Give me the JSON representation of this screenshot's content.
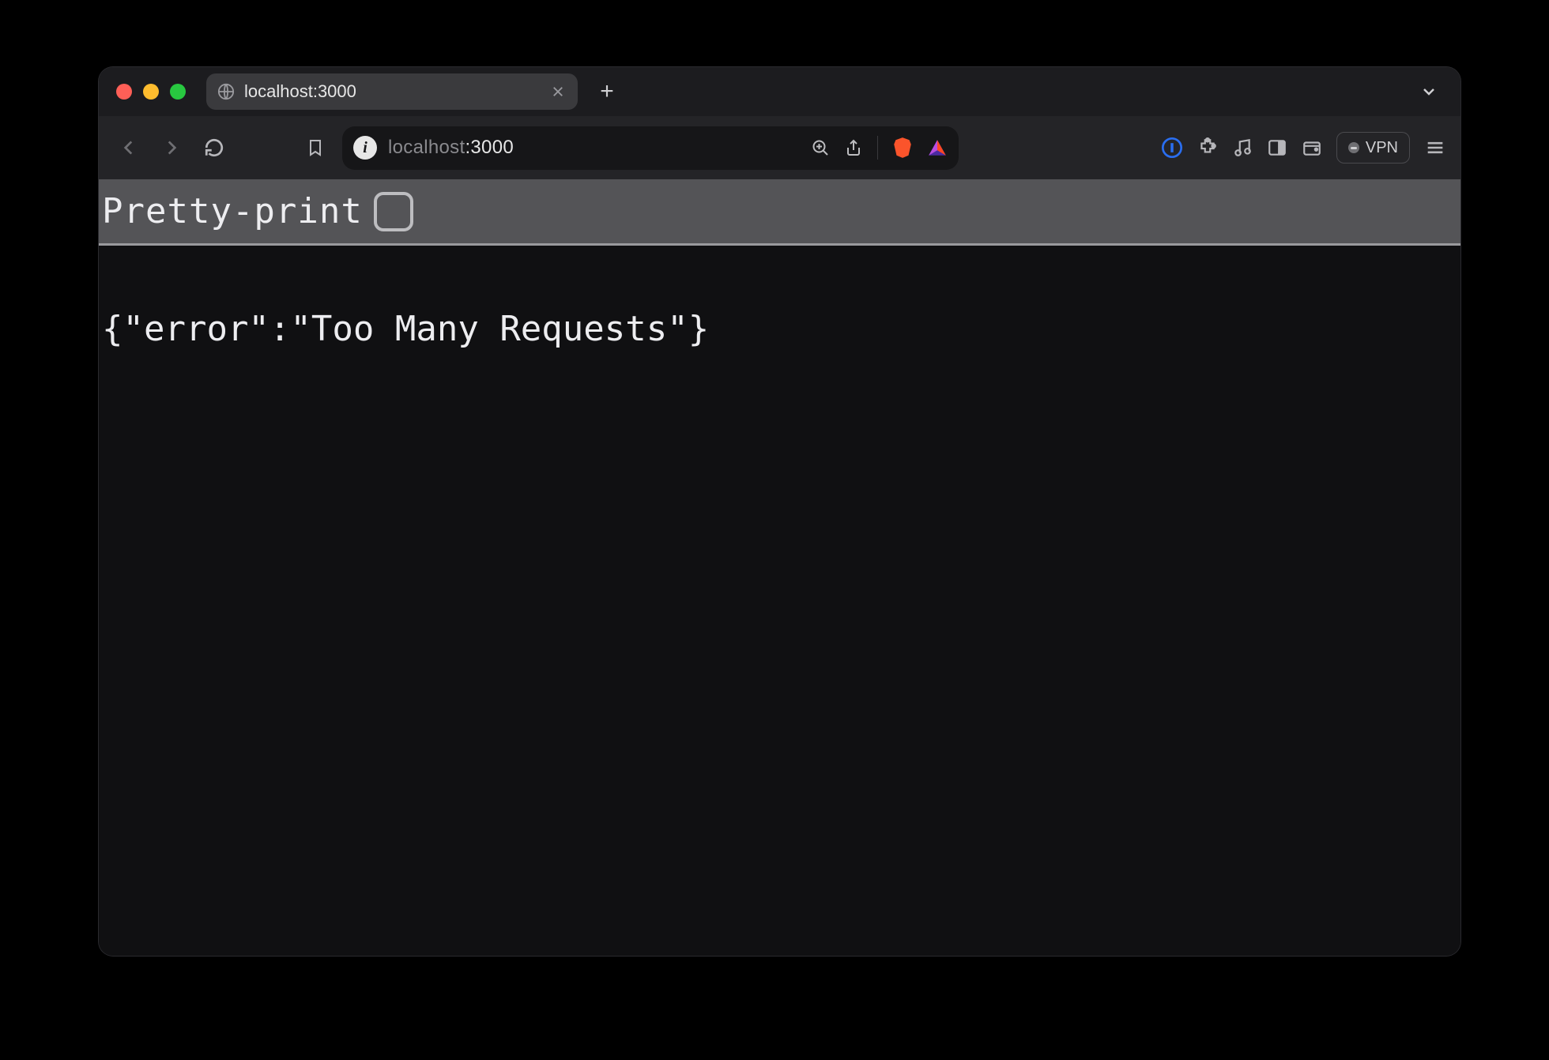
{
  "tab": {
    "title": "localhost:3000"
  },
  "address": {
    "host": "localhost",
    "port": ":3000"
  },
  "prettyprint": {
    "label": "Pretty-print",
    "checked": false
  },
  "body_text": "{\"error\":\"Too Many Requests\"}",
  "vpn": {
    "label": "VPN"
  }
}
